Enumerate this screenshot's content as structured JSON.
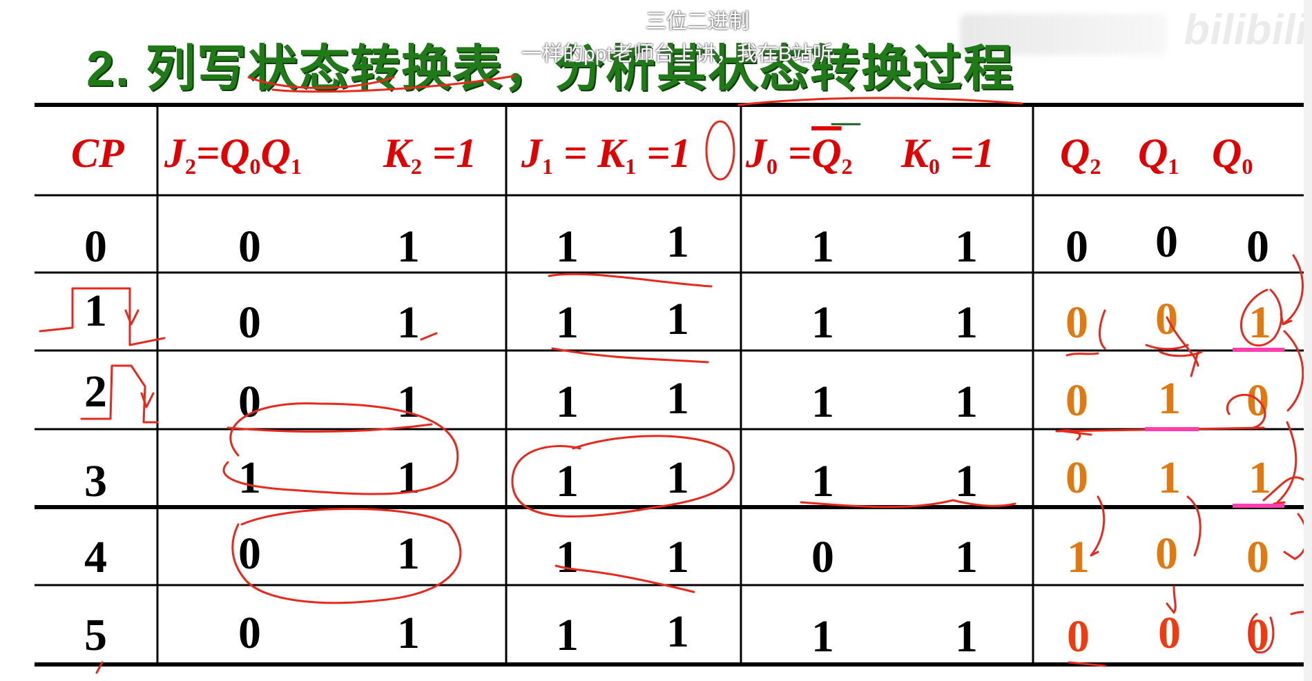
{
  "overlay": {
    "title_small": "三位二进制",
    "subtitle": "一样的ppt老师台上讲，我在B站听",
    "watermark": "bilibili"
  },
  "slide_title": "2. 列写状态转换表，分析其状态转换过程",
  "table": {
    "headers": {
      "cp": "CP",
      "j2": "J",
      "j2_sub": "2",
      "j2_eq": "=Q",
      "j2_q0": "0",
      "j2_q": "Q",
      "j2_q1": "1",
      "k2": "K",
      "k2_sub": "2",
      "k2_eq": " =1",
      "j1": "J",
      "j1_sub": "1",
      "j1_eq": " = K",
      "k1_sub": "1",
      "k1_eq": " =1",
      "j0": "J",
      "j0_sub": "0",
      "j0_eq": " =",
      "j0_q": "Q",
      "j0_qsub": "2",
      "k0": "K",
      "k0_sub": "0",
      "k0_eq": " =1",
      "q2": "Q",
      "q2_sub": "2",
      "q1": "Q",
      "q1_sub": "1",
      "q0": "Q",
      "q0_sub": "0"
    },
    "rows": [
      {
        "cp": "0",
        "j2": "0",
        "k2": "1",
        "j1": "1",
        "k1": "1",
        "j0": "1",
        "k0": "1",
        "q2": "0",
        "q1": "0",
        "q0": "0"
      },
      {
        "cp": "1",
        "j2": "0",
        "k2": "1",
        "j1": "1",
        "k1": "1",
        "j0": "1",
        "k0": "1",
        "q2": "0",
        "q1": "0",
        "q0": "1"
      },
      {
        "cp": "2",
        "j2": "0",
        "k2": "1",
        "j1": "1",
        "k1": "1",
        "j0": "1",
        "k0": "1",
        "q2": "0",
        "q1": "1",
        "q0": "0"
      },
      {
        "cp": "3",
        "j2": "1",
        "k2": "1",
        "j1": "1",
        "k1": "1",
        "j0": "1",
        "k0": "1",
        "q2": "0",
        "q1": "1",
        "q0": "1"
      },
      {
        "cp": "4",
        "j2": "0",
        "k2": "1",
        "j1": "1",
        "k1": "1",
        "j0": "0",
        "k0": "1",
        "q2": "1",
        "q1": "0",
        "q0": "0"
      },
      {
        "cp": "5",
        "j2": "0",
        "k2": "1",
        "j1": "1",
        "k1": "1",
        "j0": "1",
        "k0": "1",
        "q2": "0",
        "q1": "0",
        "q0": "0"
      }
    ]
  },
  "colors": {
    "title_green": "#1f7a17",
    "header_red": "#e00000",
    "state_orange": "#e07a10",
    "annotation_red": "#e8281a",
    "highlight_magenta": "#ff3fb0"
  }
}
